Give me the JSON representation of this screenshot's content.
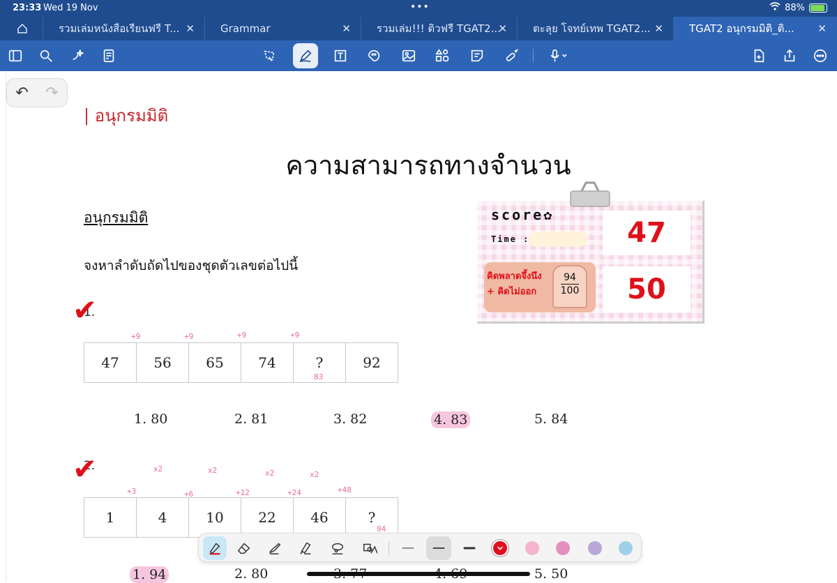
{
  "status": {
    "time": "23:33",
    "date": "Wed 19 Nov",
    "battery": "88%",
    "battery_level": 0.88
  },
  "tabs": [
    {
      "label": "รวมเล่มหนังสือเรียนฟรี T..."
    },
    {
      "label": "Grammar"
    },
    {
      "label": "รวมเล่ม!!! ติวฟรี TGAT2..."
    },
    {
      "label": "ตะลุย โจทย์เทพ TGAT2..."
    },
    {
      "label": "TGAT2 อนุกรมมิติ_ติ..."
    }
  ],
  "undo": {
    "undo_glyph": "↶",
    "redo_glyph": "↷"
  },
  "document": {
    "section_header": "| อนุกรมมิติ",
    "title": "ความสามารถทางจำนวน",
    "subheading": "อนุกรมมิติ",
    "instruction": "จงหาลำดับถัดไปของชุดตัวเลขต่อไปนี้"
  },
  "questions": [
    {
      "number": "1.",
      "check": "✔",
      "sequence": [
        "47",
        "56",
        "65",
        "74",
        "?",
        "92"
      ],
      "annotations_top": [
        "+9",
        "+9",
        "+9",
        "+9"
      ],
      "annotation_below": "83",
      "choices": [
        "1.  80",
        "2. 81",
        "3. 82",
        "4. 83",
        "5. 84"
      ],
      "selected_index": 3
    },
    {
      "number": "2.",
      "check": "✔",
      "sequence": [
        "1",
        "4",
        "10",
        "22",
        "46",
        "?"
      ],
      "annotations_ratio": [
        "x2",
        "x2",
        "x2",
        "x2"
      ],
      "annotations_add": [
        "+3",
        "+6",
        "+12",
        "+24",
        "+48"
      ],
      "annotation_below": "94",
      "choices": [
        "1. 94",
        "2. 80",
        "3. 77",
        "4. 69",
        "5. 50"
      ],
      "selected_index": 0
    }
  ],
  "scorecard": {
    "score_label": "score✿",
    "time_label": "Time :",
    "note_line1": "คิดพลาดจึ้งนึง",
    "note_line2": "+ คิดไม่ออก",
    "fraction_num": "94",
    "fraction_den": "100",
    "score": "47",
    "total": "50"
  },
  "colors": {
    "tab_bar": "#1f4c8f",
    "toolbar": "#2e64b5",
    "accent_red": "#c8262e",
    "highlight_pink": "#f6c6de",
    "pen_colors": [
      "#e0101a",
      "#f4b3cf",
      "#e48fbe",
      "#b8a7d8",
      "#9fd1e6"
    ]
  },
  "icons": {
    "toolbar": [
      "sidebar-icon",
      "search-icon",
      "ai-sparkle-icon",
      "document-icon",
      "lasso-icon",
      "pen-icon",
      "text-box-icon",
      "sticker-icon",
      "image-icon",
      "shapes-icon",
      "sticky-note-icon",
      "laser-pointer-icon",
      "microphone-icon",
      "add-page-icon",
      "share-icon",
      "more-icon"
    ],
    "pen_bar": [
      "fountain-pen-icon",
      "eraser-icon",
      "brush-icon",
      "highlighter-icon",
      "lasso-tool-icon",
      "shape-tool-icon"
    ]
  }
}
